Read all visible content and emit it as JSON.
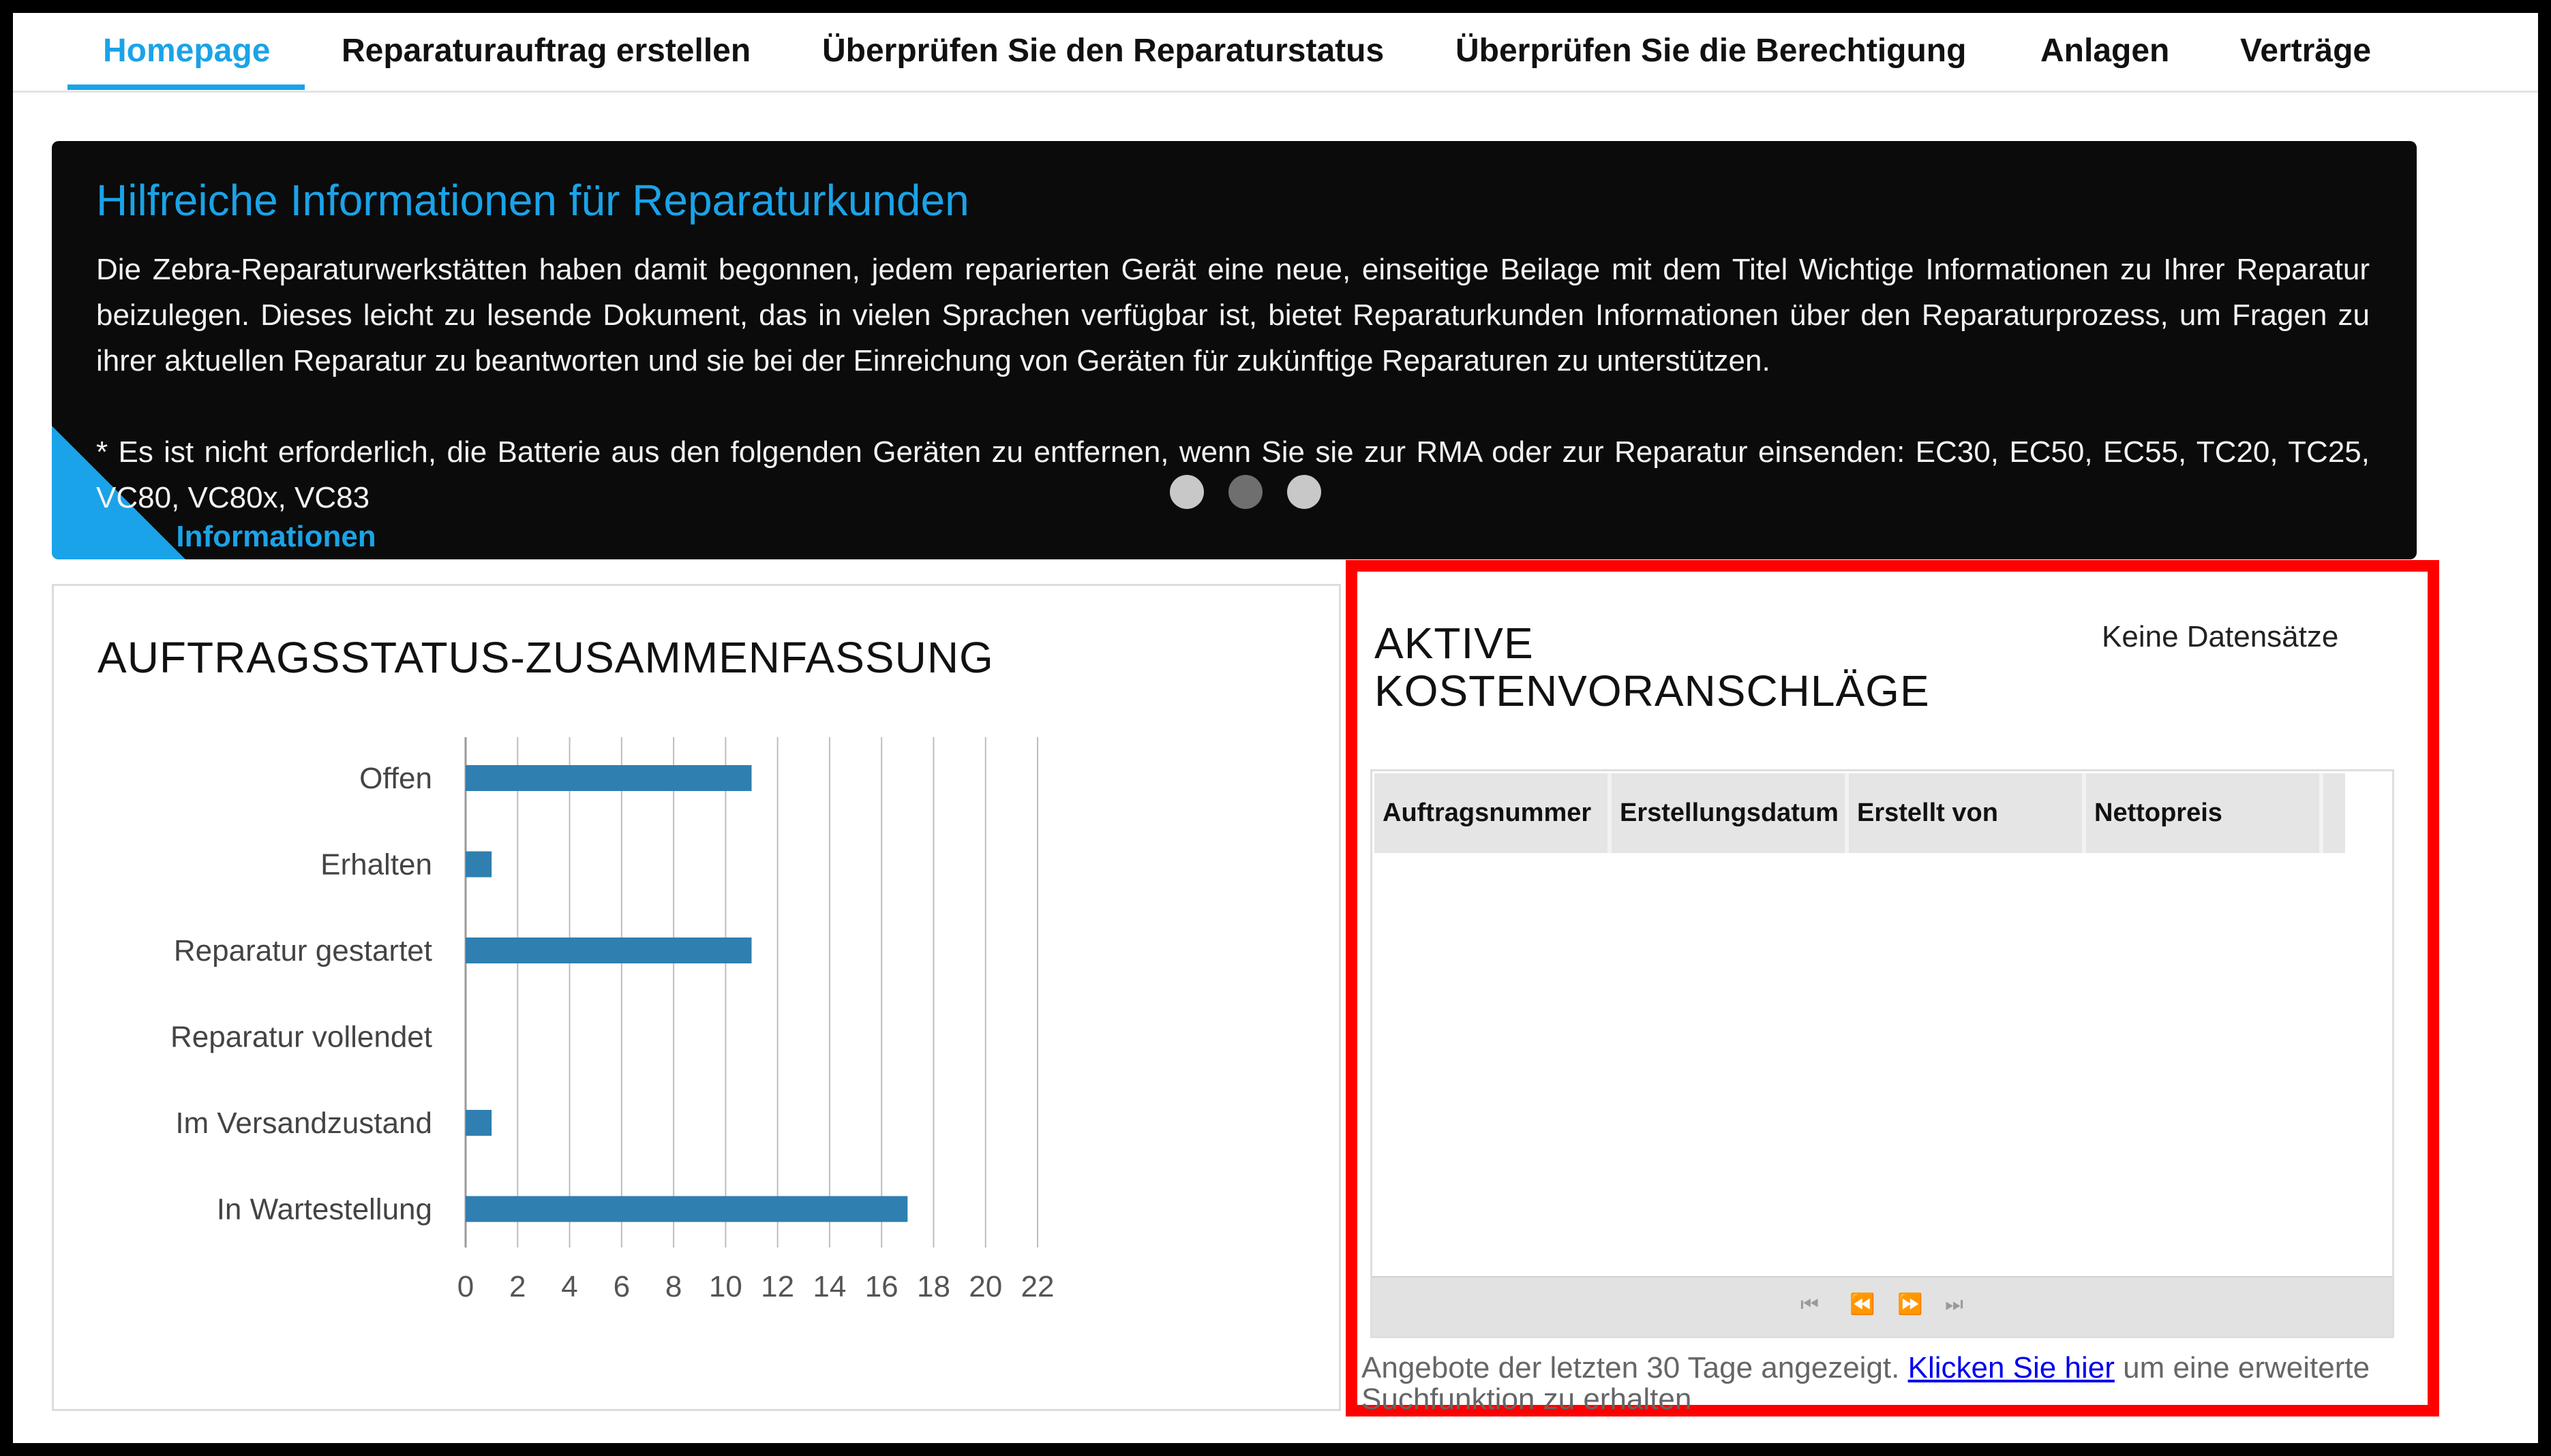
{
  "nav": {
    "items": [
      {
        "label": "Homepage",
        "active": true
      },
      {
        "label": "Reparaturauftrag erstellen",
        "active": false
      },
      {
        "label": "Überprüfen Sie den Reparaturstatus",
        "active": false
      },
      {
        "label": "Überprüfen Sie die Berechtigung",
        "active": false
      },
      {
        "label": "Anlagen",
        "active": false
      },
      {
        "label": "Verträge",
        "active": false
      }
    ]
  },
  "banner": {
    "title": "Hilfreiche Informationen für Reparaturkunden",
    "body": "Die Zebra-Reparaturwerkstätten haben damit begonnen, jedem reparierten Gerät eine neue, einseitige Beilage mit dem Titel Wichtige Informationen zu Ihrer Reparatur beizulegen. Dieses leicht zu lesende Dokument, das in vielen Sprachen verfügbar ist, bietet Reparaturkunden Informationen über den Reparaturprozess, um Fragen zu ihrer aktuellen Reparatur zu beantworten und sie bei der Einreichung von Geräten für zukünftige Reparaturen zu unterstützen.",
    "note": "* Es ist nicht erforderlich, die Batterie aus den folgenden Geräten zu entfernen, wenn Sie sie zur RMA oder zur Reparatur einsenden: EC30, EC50, EC55, TC20, TC25, VC80, VC80x, VC83",
    "link_label": "Informationen",
    "carousel": {
      "slides": 3,
      "active_index": 1
    }
  },
  "status_summary": {
    "title": "AUFTRAGSSTATUS-ZUSAMMENFASSUNG"
  },
  "chart_data": {
    "type": "bar",
    "orientation": "horizontal",
    "title": "AUFTRAGSSTATUS-ZUSAMMENFASSUNG",
    "categories": [
      "Offen",
      "Erhalten",
      "Reparatur gestartet",
      "Reparatur vollendet",
      "Im Versandzustand",
      "In Wartestellung"
    ],
    "values": [
      11,
      1,
      11,
      0,
      1,
      17
    ],
    "xlim": [
      0,
      22
    ],
    "xticks": [
      0,
      2,
      4,
      6,
      8,
      10,
      12,
      14,
      16,
      18,
      20,
      22
    ],
    "xlabel": "",
    "ylabel": "",
    "grid": true,
    "bar_color": "#2f7fb0"
  },
  "estimates": {
    "title": "AKTIVE KOSTENVORANSCHLÄGE",
    "empty_label": "Keine Datensätze",
    "columns": [
      "Auftragsnummer",
      "Erstellungsdatum",
      "Erstellt von",
      "Nettopreis"
    ],
    "rows": [],
    "pager": {
      "first_icon": "first-page-icon",
      "prev_icon": "prev-page-icon",
      "next_icon": "next-page-icon",
      "last_icon": "last-page-icon"
    },
    "footnote_prefix": "Angebote der letzten 30 Tage angezeigt.",
    "footnote_link": "Klicken Sie hier",
    "footnote_suffix": "um eine erweiterte Suchfunktion zu erhalten"
  },
  "colors": {
    "accent": "#1aa3e8",
    "highlight_border": "#ff0000",
    "banner_bg": "#0b0b0b"
  }
}
